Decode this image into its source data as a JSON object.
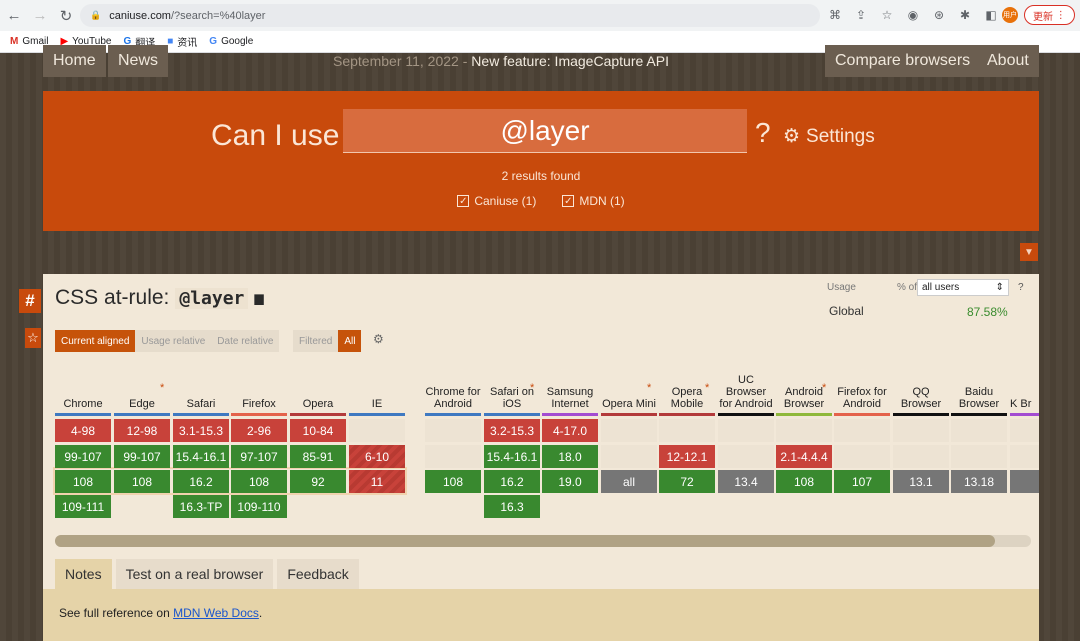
{
  "browser": {
    "url_host": "caniuse.com",
    "url_path": "/?search=%40layer",
    "update_label": "更新",
    "avatar_text": "用户",
    "bookmarks": [
      {
        "label": "Gmail",
        "icon": "gmail-icon",
        "mark": "M",
        "color": "#d93025"
      },
      {
        "label": "YouTube",
        "icon": "youtube-icon",
        "mark": "▶",
        "color": "#ff0000"
      },
      {
        "label": "翻译",
        "icon": "translate-icon",
        "mark": "G",
        "color": "#1a73e8"
      },
      {
        "label": "资讯",
        "icon": "news-icon",
        "mark": "■",
        "color": "#4285f4"
      },
      {
        "label": "Google",
        "icon": "google-icon",
        "mark": "G",
        "color": "#4285f4"
      }
    ]
  },
  "nav": {
    "home": "Home",
    "news": "News",
    "news_date": "September 11, 2022",
    "news_sep": " - ",
    "news_feature": "New feature: ImageCapture API",
    "compare": "Compare browsers",
    "about": "About"
  },
  "hero": {
    "canuse": "Can I use",
    "query": "@layer",
    "question": "?",
    "settings": "Settings",
    "results": "2 results found",
    "filter1": "Caniuse (1)",
    "filter2": "MDN (1)"
  },
  "feature": {
    "title_prefix": "CSS at-rule:",
    "title_code": "@layer",
    "usage_label": "Usage",
    "pct_of": "% of",
    "user_select": "all users",
    "user_q": "?",
    "global_label": "Global",
    "global_pct": "87.58%",
    "view_tabs": [
      "Current aligned",
      "Usage relative",
      "Date relative"
    ],
    "filter_tabs": [
      "Filtered",
      "All"
    ],
    "anchor": "#",
    "star": "☆"
  },
  "colors": {
    "supported": "#39892f",
    "unsupported": "#c8423a",
    "unknown": "#767676",
    "hero": "#c84a0c"
  },
  "browsers": [
    {
      "name": "Chrome",
      "bar": "#3f79c1",
      "ast": false,
      "cells": [
        {
          "v": "4-98",
          "s": "n"
        },
        {
          "v": "99-107",
          "s": "y"
        },
        {
          "v": "108",
          "s": "y"
        },
        {
          "v": "109-111",
          "s": "y"
        }
      ]
    },
    {
      "name": "Edge",
      "bar": "#3f79c1",
      "ast": true,
      "cells": [
        {
          "v": "12-98",
          "s": "n"
        },
        {
          "v": "99-107",
          "s": "y"
        },
        {
          "v": "108",
          "s": "y"
        }
      ]
    },
    {
      "name": "Safari",
      "bar": "#3f79c1",
      "ast": false,
      "cells": [
        {
          "v": "3.1-15.3",
          "s": "n"
        },
        {
          "v": "15.4-16.1",
          "s": "y"
        },
        {
          "v": "16.2",
          "s": "y"
        },
        {
          "v": "16.3-TP",
          "s": "y"
        }
      ]
    },
    {
      "name": "Firefox",
      "bar": "#e4624a",
      "ast": false,
      "cells": [
        {
          "v": "2-96",
          "s": "n"
        },
        {
          "v": "97-107",
          "s": "y"
        },
        {
          "v": "108",
          "s": "y"
        },
        {
          "v": "109-110",
          "s": "y"
        }
      ]
    },
    {
      "name": "Opera",
      "bar": "#b33a3a",
      "ast": false,
      "cells": [
        {
          "v": "10-84",
          "s": "n"
        },
        {
          "v": "85-91",
          "s": "y"
        },
        {
          "v": "92",
          "s": "y"
        }
      ]
    },
    {
      "name": "IE",
      "bar": "#3f79c1",
      "ast": false,
      "cells": [
        {
          "v": "",
          "s": "e"
        },
        {
          "v": "6-10",
          "s": "n"
        },
        {
          "v": "11",
          "s": "n"
        }
      ]
    },
    {
      "name": "Chrome for Android",
      "bar": "#3f79c1",
      "ast": false,
      "cells": [
        {
          "v": "",
          "s": "e"
        },
        {
          "v": "",
          "s": "e"
        },
        {
          "v": "108",
          "s": "y"
        }
      ]
    },
    {
      "name": "Safari on iOS",
      "bar": "#3f79c1",
      "ast": true,
      "cells": [
        {
          "v": "3.2-15.3",
          "s": "n"
        },
        {
          "v": "15.4-16.1",
          "s": "y"
        },
        {
          "v": "16.2",
          "s": "y"
        },
        {
          "v": "16.3",
          "s": "y"
        }
      ]
    },
    {
      "name": "Samsung Internet",
      "bar": "#a34bd1",
      "ast": false,
      "cells": [
        {
          "v": "4-17.0",
          "s": "n"
        },
        {
          "v": "18.0",
          "s": "y"
        },
        {
          "v": "19.0",
          "s": "y"
        }
      ]
    },
    {
      "name": "Opera Mini",
      "bar": "#b33a3a",
      "ast": true,
      "cells": [
        {
          "v": "",
          "s": "e"
        },
        {
          "v": "",
          "s": "e"
        },
        {
          "v": "all",
          "s": "u"
        }
      ]
    },
    {
      "name": "Opera Mobile",
      "bar": "#b33a3a",
      "ast": true,
      "cells": [
        {
          "v": "",
          "s": "e"
        },
        {
          "v": "12-12.1",
          "s": "n"
        },
        {
          "v": "72",
          "s": "y"
        }
      ]
    },
    {
      "name": "UC Browser for Android",
      "bar": "#111111",
      "ast": false,
      "cells": [
        {
          "v": "",
          "s": "e"
        },
        {
          "v": "",
          "s": "e"
        },
        {
          "v": "13.4",
          "s": "u"
        }
      ]
    },
    {
      "name": "Android Browser",
      "bar": "#8fb83a",
      "ast": true,
      "cells": [
        {
          "v": "",
          "s": "e"
        },
        {
          "v": "2.1-4.4.4",
          "s": "n"
        },
        {
          "v": "108",
          "s": "y"
        }
      ]
    },
    {
      "name": "Firefox for Android",
      "bar": "#e4624a",
      "ast": false,
      "cells": [
        {
          "v": "",
          "s": "e"
        },
        {
          "v": "",
          "s": "e"
        },
        {
          "v": "107",
          "s": "y"
        }
      ]
    },
    {
      "name": "QQ Browser",
      "bar": "#111111",
      "ast": false,
      "cells": [
        {
          "v": "",
          "s": "e"
        },
        {
          "v": "",
          "s": "e"
        },
        {
          "v": "13.1",
          "s": "u"
        }
      ]
    },
    {
      "name": "Baidu Browser",
      "bar": "#111111",
      "ast": false,
      "cells": [
        {
          "v": "",
          "s": "e"
        },
        {
          "v": "",
          "s": "e"
        },
        {
          "v": "13.18",
          "s": "u"
        }
      ]
    },
    {
      "name": "K Br",
      "bar": "#a34bd1",
      "ast": false,
      "cells": [
        {
          "v": "",
          "s": "e"
        },
        {
          "v": "",
          "s": "e"
        },
        {
          "v": "",
          "s": "u"
        }
      ]
    }
  ],
  "bottom": {
    "tabs": [
      "Notes",
      "Test on a real browser",
      "Feedback"
    ],
    "notes_text": "See full reference on ",
    "notes_link": "MDN Web Docs",
    "notes_end": "."
  }
}
